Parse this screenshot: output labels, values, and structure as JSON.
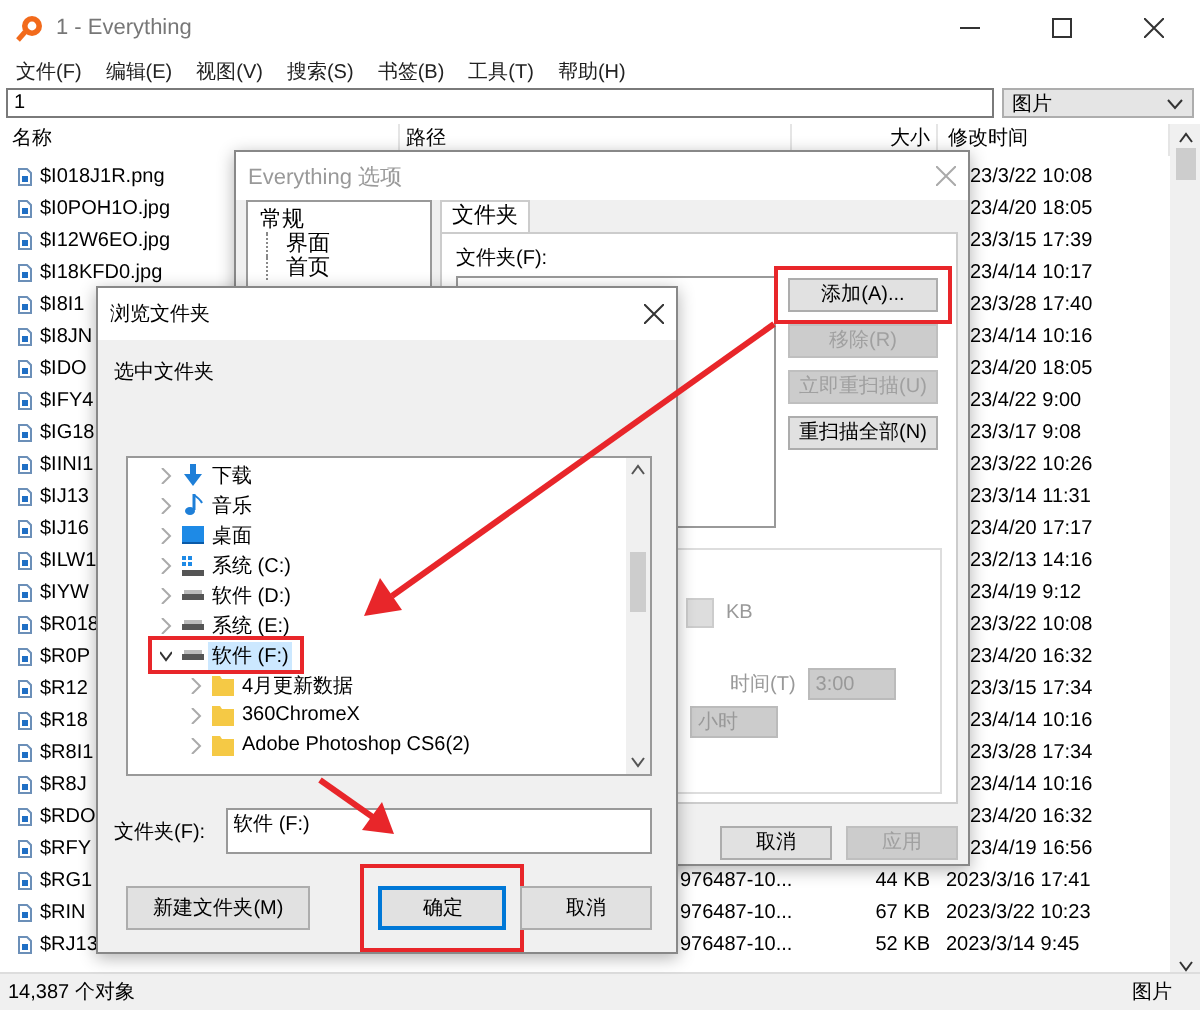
{
  "window": {
    "title": "1 - Everything"
  },
  "menu": [
    "文件(F)",
    "编辑(E)",
    "视图(V)",
    "搜索(S)",
    "书签(B)",
    "工具(T)",
    "帮助(H)"
  ],
  "search": {
    "value": "1"
  },
  "filter": {
    "value": "图片"
  },
  "columns": [
    "名称",
    "路径",
    "大小",
    "修改时间"
  ],
  "rows": [
    {
      "name": "$I018J1R.png",
      "modified": "23/3/22 10:08"
    },
    {
      "name": "$I0POH1O.jpg",
      "modified": "23/4/20 18:05"
    },
    {
      "name": "$I12W6EO.jpg",
      "modified": "23/3/15 17:39"
    },
    {
      "name": "$I18KFD0.jpg",
      "modified": "23/4/14 10:17"
    },
    {
      "name": "$I8I1",
      "modified": "23/3/28 17:40"
    },
    {
      "name": "$I8JN",
      "modified": "23/4/14 10:16"
    },
    {
      "name": "$IDO",
      "modified": "23/4/20 18:05"
    },
    {
      "name": "$IFY4",
      "modified": "23/4/22 9:00"
    },
    {
      "name": "$IG18",
      "modified": "23/3/17 9:08"
    },
    {
      "name": "$IINI1",
      "modified": "23/3/22 10:26"
    },
    {
      "name": "$IJ13",
      "modified": "23/3/14 11:31"
    },
    {
      "name": "$IJ16",
      "modified": "23/4/20 17:17"
    },
    {
      "name": "$ILW1",
      "modified": "23/2/13 14:16"
    },
    {
      "name": "$IYW",
      "modified": "23/4/19 9:12"
    },
    {
      "name": "$R018",
      "modified": "23/3/22 10:08"
    },
    {
      "name": "$R0P",
      "modified": "23/4/20 16:32"
    },
    {
      "name": "$R12",
      "modified": "23/3/15 17:34"
    },
    {
      "name": "$R18",
      "modified": "23/4/14 10:16"
    },
    {
      "name": "$R8I1",
      "modified": "23/3/28 17:34"
    },
    {
      "name": "$R8J",
      "modified": "23/4/14 10:16"
    },
    {
      "name": "$RDO",
      "modified": "23/4/20 16:32"
    },
    {
      "name": "$RFY",
      "modified": "23/4/19 16:56"
    },
    {
      "name": "$RG1",
      "path": "976487-10...",
      "size": "44 KB",
      "modified": "2023/3/16 17:41"
    },
    {
      "name": "$RIN",
      "path": "976487-10...",
      "size": "67 KB",
      "modified": "2023/3/22 10:23"
    },
    {
      "name": "$RJ13",
      "path": "976487-10...",
      "size": "52 KB",
      "modified": "2023/3/14 9:45"
    }
  ],
  "status_bar": {
    "count": "14,387 个对象",
    "filter": "图片"
  },
  "options_dialog": {
    "title": "Everything 选项",
    "tree": [
      {
        "label": "常规",
        "children": [
          {
            "label": "界面"
          },
          {
            "label": "首页"
          }
        ]
      }
    ],
    "tabs": [
      {
        "label": "文件夹",
        "selected": true
      }
    ],
    "folders_label": "文件夹(F):",
    "buttons": [
      {
        "label": "添加(A)...",
        "disabled": false,
        "highlighted": true
      },
      {
        "label": "移除(R)",
        "disabled": true,
        "highlighted": false
      },
      {
        "label": "立即重扫描(U)",
        "disabled": true,
        "highlighted": false
      },
      {
        "label": "重扫描全部(N)",
        "disabled": false,
        "highlighted": false
      }
    ],
    "size_unit": "KB",
    "time_label": "时间(T)",
    "time": "3:00",
    "interval": "小时",
    "footer_buttons": [
      {
        "label": "取消",
        "disabled": false
      },
      {
        "label": "应用",
        "disabled": true
      }
    ]
  },
  "browse_dialog": {
    "title": "浏览文件夹",
    "prompt": "选中文件夹",
    "tree": [
      {
        "label": "下载",
        "kind": "download",
        "expanded": false,
        "selected": false,
        "highlighted": false
      },
      {
        "label": "音乐",
        "kind": "music",
        "expanded": false,
        "selected": false,
        "highlighted": false
      },
      {
        "label": "桌面",
        "kind": "desktop",
        "expanded": false,
        "selected": false,
        "highlighted": false
      },
      {
        "label": "系统 (C:)",
        "kind": "system-drive",
        "expanded": false,
        "selected": false,
        "highlighted": false
      },
      {
        "label": "软件 (D:)",
        "kind": "drive",
        "expanded": false,
        "selected": false,
        "highlighted": false
      },
      {
        "label": "系统 (E:)",
        "kind": "drive",
        "expanded": false,
        "selected": false,
        "highlighted": false
      },
      {
        "label": "软件 (F:)",
        "kind": "drive",
        "expanded": true,
        "selected": true,
        "highlighted": true,
        "children": [
          {
            "label": "4月更新数据",
            "kind": "folder",
            "expanded": false,
            "selected": false,
            "highlighted": false
          },
          {
            "label": "360ChromeX",
            "kind": "folder",
            "expanded": false,
            "selected": false,
            "highlighted": false
          },
          {
            "label": "Adobe Photoshop CS6(2)",
            "kind": "folder",
            "expanded": false,
            "selected": false,
            "highlighted": false
          }
        ]
      }
    ],
    "folder_label": "文件夹(F):",
    "folder_value": "软件 (F:)",
    "buttons": [
      {
        "label": "新建文件夹(M)",
        "default": false,
        "highlighted": false
      },
      {
        "label": "确定",
        "default": true,
        "highlighted": true
      },
      {
        "label": "取消",
        "default": false,
        "highlighted": false
      }
    ]
  }
}
